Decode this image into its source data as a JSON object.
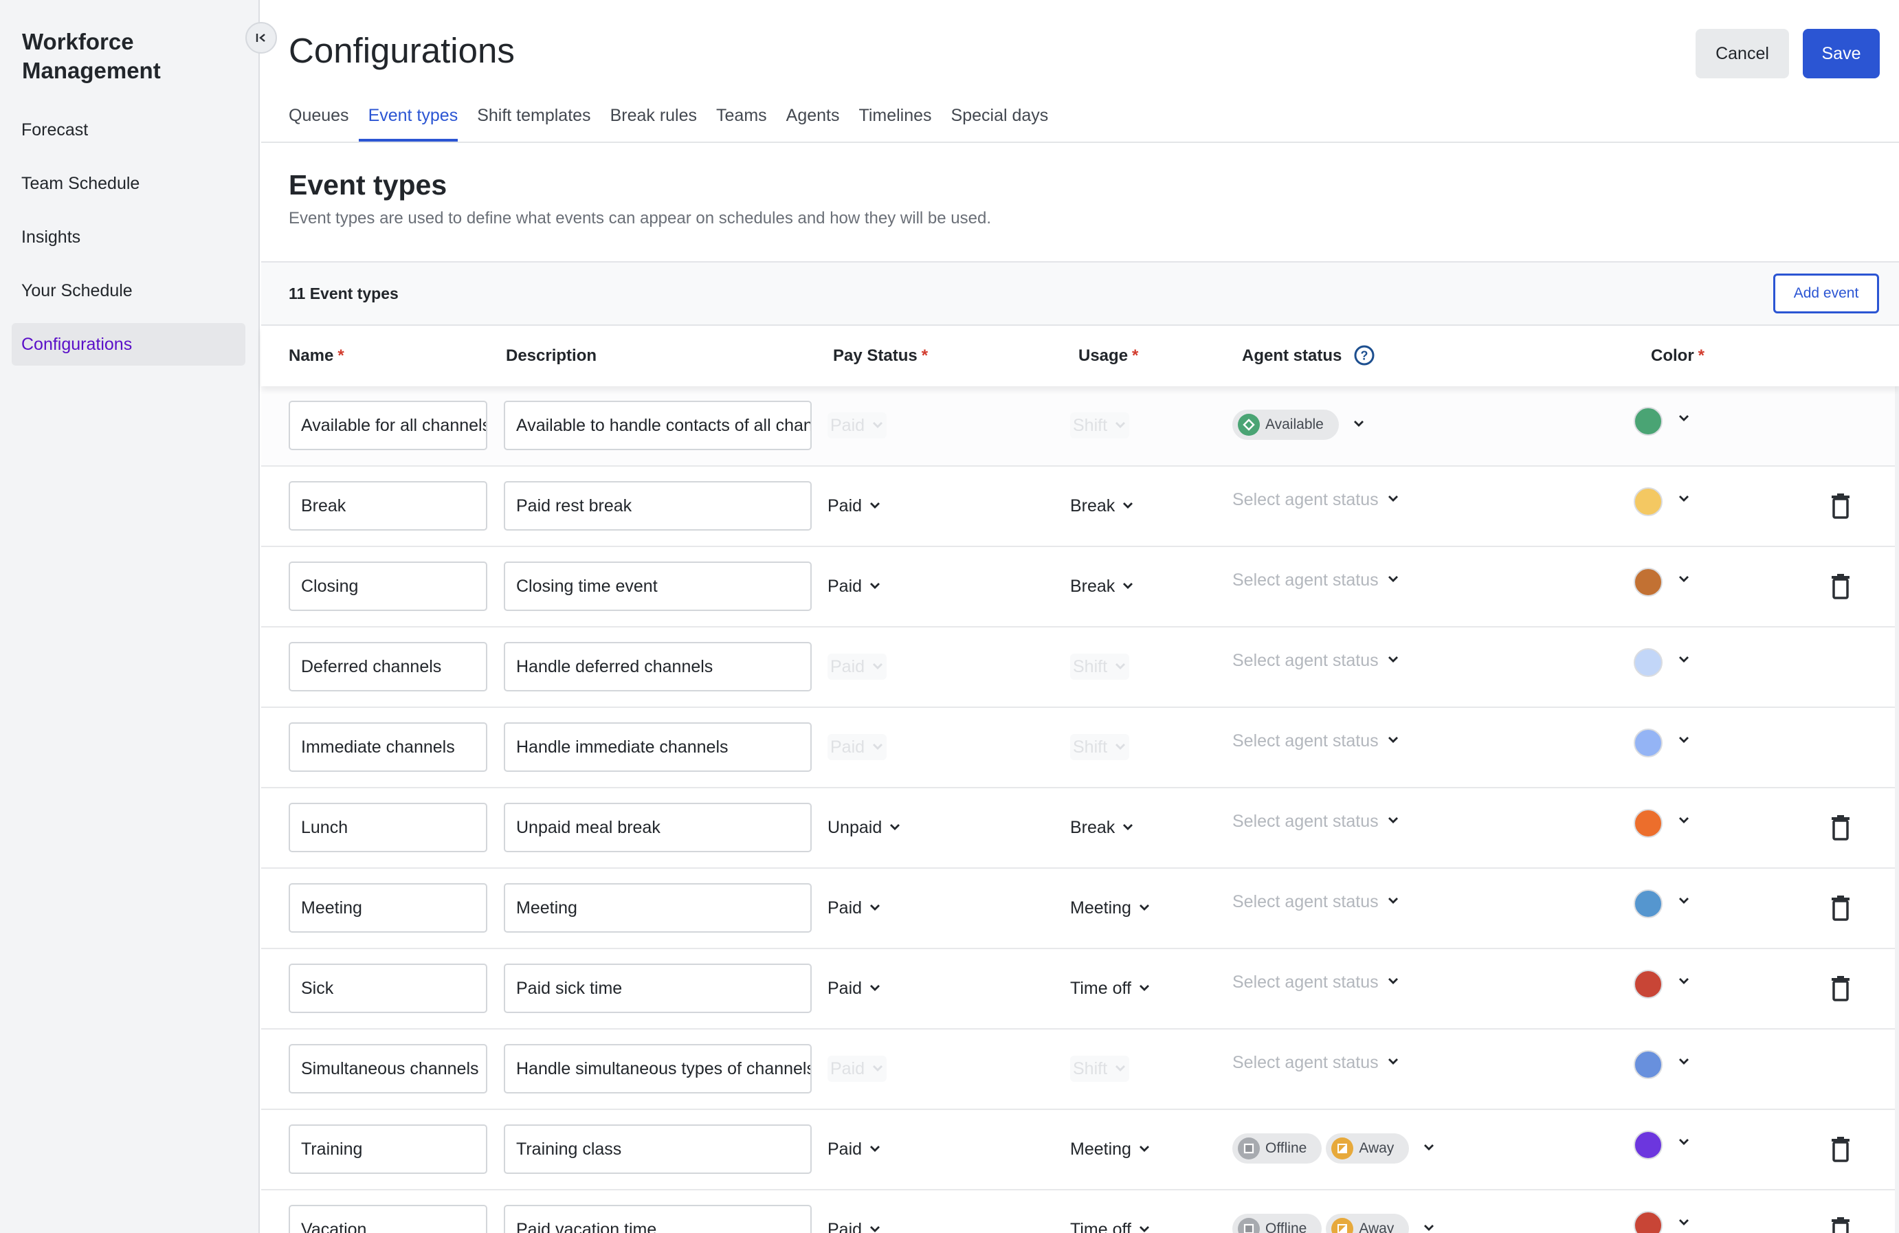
{
  "sidebar": {
    "app_title": "Workforce Management",
    "collapse_icon": "collapse-left-icon",
    "items": [
      {
        "label": "Forecast",
        "active": false
      },
      {
        "label": "Team Schedule",
        "active": false
      },
      {
        "label": "Insights",
        "active": false
      },
      {
        "label": "Your Schedule",
        "active": false
      },
      {
        "label": "Configurations",
        "active": true
      }
    ]
  },
  "header": {
    "title": "Configurations",
    "cancel_label": "Cancel",
    "save_label": "Save",
    "tabs": [
      {
        "label": "Queues",
        "active": false
      },
      {
        "label": "Event types",
        "active": true
      },
      {
        "label": "Shift templates",
        "active": false
      },
      {
        "label": "Break rules",
        "active": false
      },
      {
        "label": "Teams",
        "active": false
      },
      {
        "label": "Agents",
        "active": false
      },
      {
        "label": "Timelines",
        "active": false
      },
      {
        "label": "Special days",
        "active": false
      }
    ]
  },
  "section": {
    "title": "Event types",
    "subtitle": "Event types are used to define what events can appear on schedules and how they will be used.",
    "count_label": "11 Event types",
    "add_label": "Add event"
  },
  "table": {
    "columns": {
      "name": "Name",
      "description": "Description",
      "pay_status": "Pay Status",
      "usage": "Usage",
      "agent_status": "Agent status",
      "color": "Color",
      "required_mark": "*"
    },
    "agent_status_placeholder": "Select agent status",
    "rows": [
      {
        "name": "Available for all channels",
        "description": "Available to handle contacts of all channels",
        "pay": "Paid",
        "usage": "Shift",
        "locked": true,
        "agent_status": [
          {
            "label": "Available",
            "icon": "available-diamond-icon",
            "color": "#4aa474"
          }
        ],
        "color": "#4aa474",
        "deletable": false
      },
      {
        "name": "Break",
        "description": "Paid rest break",
        "pay": "Paid",
        "usage": "Break",
        "locked": false,
        "agent_status": [],
        "color": "#f4c862",
        "deletable": true
      },
      {
        "name": "Closing",
        "description": "Closing time event",
        "pay": "Paid",
        "usage": "Break",
        "locked": false,
        "agent_status": [],
        "color": "#c27133",
        "deletable": true
      },
      {
        "name": "Deferred channels",
        "description": "Handle deferred channels",
        "pay": "Paid",
        "usage": "Shift",
        "locked": true,
        "agent_status": [],
        "color": "#c2d6f8",
        "deletable": false
      },
      {
        "name": "Immediate channels",
        "description": "Handle immediate channels",
        "pay": "Paid",
        "usage": "Shift",
        "locked": true,
        "agent_status": [],
        "color": "#94b4f5",
        "deletable": false
      },
      {
        "name": "Lunch",
        "description": "Unpaid meal break",
        "pay": "Unpaid",
        "usage": "Break",
        "locked": false,
        "agent_status": [],
        "color": "#ec6e2c",
        "deletable": true
      },
      {
        "name": "Meeting",
        "description": "Meeting",
        "pay": "Paid",
        "usage": "Meeting",
        "locked": false,
        "agent_status": [],
        "color": "#5596cf",
        "deletable": true
      },
      {
        "name": "Sick",
        "description": "Paid sick time",
        "pay": "Paid",
        "usage": "Time off",
        "locked": false,
        "agent_status": [],
        "color": "#c84536",
        "deletable": true
      },
      {
        "name": "Simultaneous channels",
        "description": "Handle simultaneous types of channels",
        "pay": "Paid",
        "usage": "Shift",
        "locked": true,
        "agent_status": [],
        "color": "#6890dd",
        "deletable": false
      },
      {
        "name": "Training",
        "description": "Training class",
        "pay": "Paid",
        "usage": "Meeting",
        "locked": false,
        "agent_status": [
          {
            "label": "Offline",
            "icon": "offline-square-icon",
            "color": "#a7aaaf"
          },
          {
            "label": "Away",
            "icon": "away-triangle-icon",
            "color": "#e7a93b"
          }
        ],
        "color": "#6c36de",
        "deletable": true
      },
      {
        "name": "Vacation",
        "description": "Paid vacation time",
        "pay": "Paid",
        "usage": "Time off",
        "locked": false,
        "agent_status": [
          {
            "label": "Offline",
            "icon": "offline-square-icon",
            "color": "#a7aaaf"
          },
          {
            "label": "Away",
            "icon": "away-triangle-icon",
            "color": "#e7a93b"
          }
        ],
        "color": "#c84536",
        "deletable": true
      }
    ]
  },
  "colors": {
    "accent": "#2b55d3",
    "nav_active_text": "#5a0fc8",
    "required": "#d23c2e"
  }
}
